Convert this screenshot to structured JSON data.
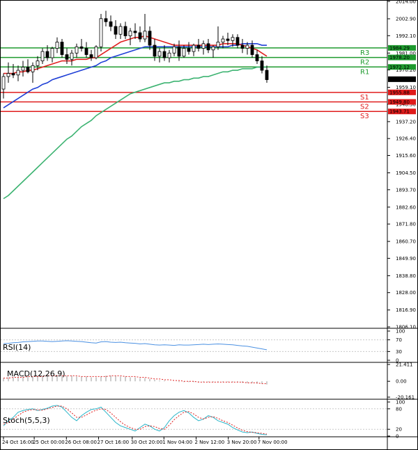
{
  "chart_data": [
    {
      "type": "candlestick",
      "panel": "price",
      "ylim": [
        1806.1,
        2014.0
      ],
      "y_ticks": [
        "2014.00",
        "2002.90",
        "1992.10",
        "1981.00",
        "1970.20",
        "1959.10",
        "1948.30",
        "1937.20",
        "1926.40",
        "1915.60",
        "1904.50",
        "1893.70",
        "1882.60",
        "1871.80",
        "1860.70",
        "1849.90",
        "1838.80",
        "1828.00",
        "1816.90",
        "1806.10"
      ],
      "x_ticks": [
        "24 Oct 16:00",
        "25 Oct 00:00",
        "26 Oct 08:00",
        "27 Oct 16:00",
        "30 Oct 20:00",
        "1 Nov 04:00",
        "2 Nov 12:00",
        "3 Nov 20:00",
        "7 Nov 00:00"
      ],
      "candles": [
        [
          1958,
          1968,
          1952,
          1966
        ],
        [
          1966,
          1975,
          1962,
          1968
        ],
        [
          1968,
          1974,
          1965,
          1967
        ],
        [
          1967,
          1973,
          1963,
          1970
        ],
        [
          1970,
          1976,
          1966,
          1972
        ],
        [
          1972,
          1977,
          1968,
          1969
        ],
        [
          1969,
          1975,
          1962,
          1973
        ],
        [
          1973,
          1979,
          1970,
          1976
        ],
        [
          1976,
          1984,
          1974,
          1982
        ],
        [
          1982,
          1986,
          1976,
          1978
        ],
        [
          1978,
          1985,
          1975,
          1984
        ],
        [
          1984,
          1991,
          1981,
          1988
        ],
        [
          1988,
          1990,
          1978,
          1980
        ],
        [
          1980,
          1984,
          1974,
          1977
        ],
        [
          1977,
          1983,
          1973,
          1981
        ],
        [
          1981,
          1987,
          1978,
          1985
        ],
        [
          1985,
          1990,
          1982,
          1984
        ],
        [
          1984,
          1988,
          1978,
          1980
        ],
        [
          1980,
          1983,
          1976,
          1978
        ],
        [
          1978,
          1986,
          1977,
          1985
        ],
        [
          1985,
          2006,
          1982,
          2003
        ],
        [
          2003,
          2008,
          1998,
          2001
        ],
        [
          2001,
          2005,
          1995,
          1998
        ],
        [
          1998,
          2002,
          1990,
          1993
        ],
        [
          1993,
          2000,
          1990,
          1998
        ],
        [
          1998,
          2001,
          1990,
          1992
        ],
        [
          1992,
          1997,
          1986,
          1995
        ],
        [
          1995,
          2000,
          1990,
          1994
        ],
        [
          1994,
          1998,
          1988,
          1990
        ],
        [
          1990,
          2006,
          1988,
          1995
        ],
        [
          1995,
          1998,
          1983,
          1986
        ],
        [
          1986,
          1990,
          1976,
          1979
        ],
        [
          1979,
          1984,
          1975,
          1982
        ],
        [
          1982,
          1986,
          1976,
          1978
        ],
        [
          1978,
          1983,
          1975,
          1981
        ],
        [
          1981,
          1987,
          1979,
          1985
        ],
        [
          1985,
          1989,
          1976,
          1979
        ],
        [
          1979,
          1986,
          1978,
          1984
        ],
        [
          1984,
          1988,
          1980,
          1982
        ],
        [
          1982,
          1987,
          1979,
          1986
        ],
        [
          1986,
          1990,
          1982,
          1984
        ],
        [
          1984,
          1989,
          1980,
          1987
        ],
        [
          1987,
          1990,
          1981,
          1983
        ],
        [
          1983,
          1986,
          1978,
          1985
        ],
        [
          1985,
          1998,
          1983,
          1988
        ],
        [
          1988,
          1992,
          1984,
          1990
        ],
        [
          1990,
          1994,
          1986,
          1989
        ],
        [
          1989,
          1993,
          1985,
          1991
        ],
        [
          1991,
          1993,
          1984,
          1986
        ],
        [
          1986,
          1990,
          1981,
          1984
        ],
        [
          1984,
          1988,
          1980,
          1986
        ],
        [
          1986,
          1989,
          1978,
          1980
        ],
        [
          1980,
          1983,
          1974,
          1976
        ],
        [
          1976,
          1979,
          1968,
          1970
        ],
        [
          1970,
          1973,
          1962,
          1964
        ]
      ],
      "series": [
        {
          "name": "",
          "color": "#1f3fd6",
          "values": [
            1946,
            1948,
            1950,
            1952,
            1954,
            1956,
            1958,
            1959,
            1961,
            1962,
            1964,
            1965,
            1966,
            1967,
            1968,
            1969,
            1970,
            1971,
            1972,
            1973,
            1975,
            1976,
            1978,
            1979,
            1980,
            1981,
            1982,
            1983,
            1984,
            1985,
            1985,
            1985,
            1985,
            1985,
            1985,
            1985,
            1985,
            1985,
            1985,
            1985,
            1985,
            1985,
            1985,
            1985,
            1985,
            1985,
            1985,
            1986,
            1986,
            1987,
            1987,
            1987,
            1987,
            1986,
            1986
          ]
        },
        {
          "name": "",
          "color": "#e02020",
          "values": [
            1968,
            1968,
            1968,
            1969,
            1969,
            1970,
            1970,
            1971,
            1972,
            1973,
            1974,
            1975,
            1976,
            1976,
            1976,
            1977,
            1977,
            1977,
            1978,
            1978,
            1980,
            1982,
            1984,
            1986,
            1988,
            1989,
            1990,
            1991,
            1991,
            1992,
            1991,
            1990,
            1989,
            1988,
            1987,
            1986,
            1986,
            1986,
            1986,
            1986,
            1986,
            1986,
            1986,
            1986,
            1986,
            1987,
            1987,
            1987,
            1987,
            1986,
            1985,
            1984,
            1983,
            1981,
            1979
          ]
        },
        {
          "name": "",
          "color": "#3cb371",
          "values": [
            1888,
            1890,
            1893,
            1896,
            1899,
            1902,
            1905,
            1908,
            1911,
            1914,
            1917,
            1920,
            1923,
            1926,
            1928,
            1931,
            1934,
            1936,
            1938,
            1941,
            1943,
            1945,
            1947,
            1949,
            1951,
            1953,
            1955,
            1956,
            1957,
            1958,
            1959,
            1960,
            1961,
            1962,
            1962,
            1963,
            1963,
            1964,
            1964,
            1965,
            1965,
            1966,
            1966,
            1967,
            1968,
            1969,
            1969,
            1970,
            1970,
            1971,
            1971,
            1971,
            1972,
            1972,
            1972
          ]
        }
      ],
      "levels": [
        {
          "label": "R3",
          "value": 1984.29,
          "tag": "1984.29",
          "color": "#1e9a2e"
        },
        {
          "label": "R2",
          "value": 1978.2,
          "tag": "1978.20",
          "color": "#1e9a2e"
        },
        {
          "label": "R1",
          "value": 1972.12,
          "tag": "1972.12",
          "color": "#1e9a2e"
        },
        {
          "label": "S1",
          "value": 1955.88,
          "tag": "1955.88",
          "color": "#e01b1b"
        },
        {
          "label": "S2",
          "value": 1949.8,
          "tag": "1949.80",
          "color": "#e01b1b"
        },
        {
          "label": "S3",
          "value": 1943.71,
          "tag": "1943.71",
          "color": "#e01b1b"
        }
      ],
      "last_price": {
        "value": 1964.3,
        "tag": "1964.30"
      }
    },
    {
      "type": "line",
      "panel": "rsi",
      "title": "RSI(14)",
      "ylim": [
        0,
        100
      ],
      "y_ticks": [
        "100",
        "70",
        "30",
        "0"
      ],
      "series": [
        {
          "name": "",
          "color": "#4a90e2",
          "values": [
            57,
            58,
            60,
            61,
            63,
            64,
            65,
            66,
            66,
            65,
            64,
            65,
            66,
            67,
            66,
            65,
            64,
            62,
            60,
            59,
            63,
            64,
            62,
            61,
            62,
            60,
            59,
            58,
            56,
            57,
            55,
            53,
            52,
            53,
            52,
            51,
            53,
            52,
            52,
            53,
            54,
            55,
            54,
            55,
            56,
            55,
            54,
            53,
            51,
            49,
            48,
            45,
            42,
            39,
            36
          ]
        }
      ]
    },
    {
      "type": "line",
      "panel": "macd",
      "title": "MACD(12,26,9)",
      "ylim": [
        -20.161,
        21.411
      ],
      "y_ticks": [
        "21.411",
        "0.00",
        "-20.161"
      ],
      "histogram": [
        4,
        5,
        5,
        5,
        6,
        6,
        6,
        7,
        7,
        7,
        7,
        7,
        7,
        7,
        7,
        6,
        6,
        6,
        5,
        5,
        6,
        7,
        7,
        7,
        6,
        6,
        5,
        5,
        4,
        4,
        3,
        2,
        1,
        1,
        0,
        0,
        -1,
        -1,
        -1,
        -1,
        -1,
        -1,
        -1,
        -1,
        -1,
        -1,
        -1,
        -1,
        -1,
        -2,
        -2,
        -2,
        -3,
        -3,
        -4
      ],
      "series": [
        {
          "name": "",
          "color": "#e02020",
          "values": [
            4,
            4,
            5,
            5,
            5,
            6,
            6,
            6,
            6,
            7,
            7,
            7,
            7,
            7,
            7,
            7,
            6,
            6,
            6,
            6,
            6,
            6,
            7,
            7,
            7,
            6,
            6,
            6,
            5,
            5,
            4,
            3,
            3,
            2,
            2,
            1,
            1,
            0,
            0,
            0,
            -1,
            -1,
            -1,
            -1,
            -1,
            -1,
            -1,
            -1,
            -1,
            -1,
            -2,
            -2,
            -2,
            -3,
            -3
          ]
        }
      ]
    },
    {
      "type": "line",
      "panel": "stoch",
      "title": "Stoch(5,5,3)",
      "ylim": [
        0,
        100
      ],
      "y_ticks": [
        "100",
        "80",
        "20",
        "0"
      ],
      "series": [
        {
          "name": "",
          "color": "#2bb5c9",
          "values": [
            30,
            45,
            55,
            70,
            75,
            78,
            80,
            75,
            78,
            82,
            88,
            90,
            85,
            70,
            55,
            45,
            60,
            70,
            78,
            80,
            85,
            70,
            55,
            40,
            30,
            25,
            20,
            15,
            25,
            35,
            30,
            20,
            15,
            25,
            45,
            60,
            70,
            75,
            68,
            55,
            45,
            50,
            60,
            55,
            45,
            40,
            35,
            25,
            18,
            12,
            10,
            12,
            8,
            5,
            4
          ]
        },
        {
          "name": "",
          "color": "#e02020",
          "values": [
            35,
            40,
            50,
            60,
            70,
            75,
            78,
            77,
            76,
            80,
            84,
            88,
            88,
            80,
            68,
            55,
            55,
            62,
            70,
            76,
            80,
            78,
            68,
            55,
            42,
            32,
            25,
            20,
            20,
            28,
            30,
            28,
            22,
            20,
            32,
            48,
            60,
            70,
            72,
            65,
            55,
            50,
            55,
            57,
            52,
            45,
            40,
            32,
            24,
            17,
            13,
            11,
            10,
            8,
            6
          ]
        }
      ]
    }
  ]
}
